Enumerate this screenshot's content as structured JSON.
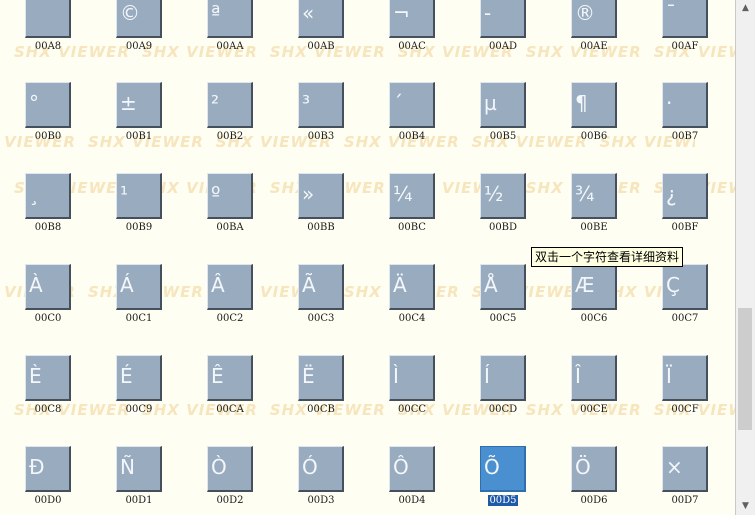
{
  "watermark": {
    "text": "SHX VIEWER"
  },
  "tooltip": {
    "text": "双击一个字符查看详细资料"
  },
  "selected_code": "00D5",
  "rows": [
    [
      {
        "code": "00A8",
        "glyph": ""
      },
      {
        "code": "00A9",
        "glyph": "©"
      },
      {
        "code": "00AA",
        "glyph": "ª"
      },
      {
        "code": "00AB",
        "glyph": "«"
      },
      {
        "code": "00AC",
        "glyph": "¬"
      },
      {
        "code": "00AD",
        "glyph": "-"
      },
      {
        "code": "00AE",
        "glyph": "®"
      },
      {
        "code": "00AF",
        "glyph": "¯"
      }
    ],
    [
      {
        "code": "00B0",
        "glyph": "°"
      },
      {
        "code": "00B1",
        "glyph": "±"
      },
      {
        "code": "00B2",
        "glyph": "²"
      },
      {
        "code": "00B3",
        "glyph": "³"
      },
      {
        "code": "00B4",
        "glyph": "´"
      },
      {
        "code": "00B5",
        "glyph": "µ"
      },
      {
        "code": "00B6",
        "glyph": "¶"
      },
      {
        "code": "00B7",
        "glyph": "·"
      }
    ],
    [
      {
        "code": "00B8",
        "glyph": "¸"
      },
      {
        "code": "00B9",
        "glyph": "¹"
      },
      {
        "code": "00BA",
        "glyph": "º"
      },
      {
        "code": "00BB",
        "glyph": "»"
      },
      {
        "code": "00BC",
        "glyph": "¼"
      },
      {
        "code": "00BD",
        "glyph": "½"
      },
      {
        "code": "00BE",
        "glyph": "¾"
      },
      {
        "code": "00BF",
        "glyph": "¿"
      }
    ],
    [
      {
        "code": "00C0",
        "glyph": "À"
      },
      {
        "code": "00C1",
        "glyph": "Á"
      },
      {
        "code": "00C2",
        "glyph": "Â"
      },
      {
        "code": "00C3",
        "glyph": "Ã"
      },
      {
        "code": "00C4",
        "glyph": "Ä"
      },
      {
        "code": "00C5",
        "glyph": "Å"
      },
      {
        "code": "00C6",
        "glyph": "Æ"
      },
      {
        "code": "00C7",
        "glyph": "Ç"
      }
    ],
    [
      {
        "code": "00C8",
        "glyph": "È"
      },
      {
        "code": "00C9",
        "glyph": "É"
      },
      {
        "code": "00CA",
        "glyph": "Ê"
      },
      {
        "code": "00CB",
        "glyph": "Ë"
      },
      {
        "code": "00CC",
        "glyph": "Ì"
      },
      {
        "code": "00CD",
        "glyph": "Í"
      },
      {
        "code": "00CE",
        "glyph": "Î"
      },
      {
        "code": "00CF",
        "glyph": "Ï"
      }
    ],
    [
      {
        "code": "00D0",
        "glyph": "Ð"
      },
      {
        "code": "00D1",
        "glyph": "Ñ"
      },
      {
        "code": "00D2",
        "glyph": "Ò"
      },
      {
        "code": "00D3",
        "glyph": "Ó"
      },
      {
        "code": "00D4",
        "glyph": "Ô"
      },
      {
        "code": "00D5",
        "glyph": "Õ"
      },
      {
        "code": "00D6",
        "glyph": "Ö"
      },
      {
        "code": "00D7",
        "glyph": "×"
      }
    ]
  ],
  "scrollbar": {
    "up_icon": "triangle-up",
    "down_icon": "triangle-down",
    "position_fraction": 0.75
  },
  "colors": {
    "background": "#fffef3",
    "tile": "#98abbf",
    "tile_selected": "#4a90d0",
    "watermark": "#f6e5bd"
  }
}
